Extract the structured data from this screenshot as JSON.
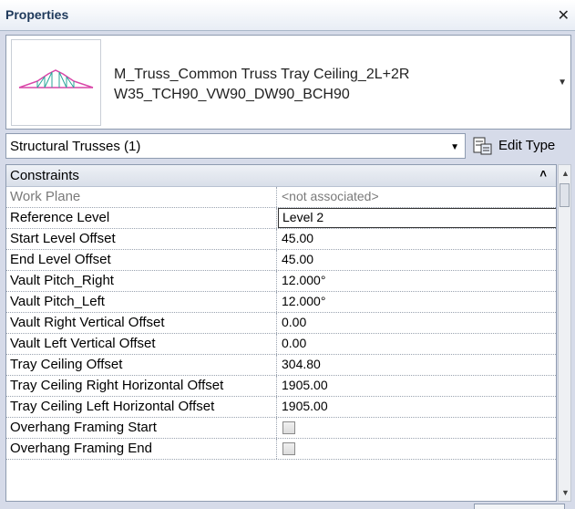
{
  "panel": {
    "title": "Properties",
    "close_glyph": "✕"
  },
  "type_selector": {
    "name_line1": "M_Truss_Common Truss Tray Ceiling_2L+2R",
    "name_line2": "W35_TCH90_VW90_DW90_BCH90",
    "arrow": "▼",
    "thumbnail_icon": "truss-thumbnail-icon"
  },
  "selection": {
    "label": "Structural Trusses (1)",
    "arrow": "▼",
    "edit_type_label": "Edit Type",
    "edit_type_icon": "edit-type-icon"
  },
  "group": {
    "label": "Constraints",
    "collapse_glyph": "«"
  },
  "rows": [
    {
      "name": "Work Plane",
      "value": "<not associated>"
    },
    {
      "name": "Reference Level",
      "value": "Level 2"
    },
    {
      "name": "Start Level Offset",
      "value": "45.00"
    },
    {
      "name": "End Level Offset",
      "value": "45.00"
    },
    {
      "name": "Vault Pitch_Right",
      "value": "12.000°"
    },
    {
      "name": "Vault Pitch_Left",
      "value": "12.000°"
    },
    {
      "name": "Vault Right Vertical Offset",
      "value": "0.00"
    },
    {
      "name": "Vault Left Vertical Offset",
      "value": "0.00"
    },
    {
      "name": "Tray Ceiling Offset",
      "value": "304.80"
    },
    {
      "name": "Tray Ceiling  Right Horizontal Offset",
      "value": "1905.00"
    },
    {
      "name": "Tray Ceiling Left Horizontal Offset",
      "value": "1905.00"
    },
    {
      "name": "Overhang Framing Start",
      "value": ""
    },
    {
      "name": "Overhang Framing End",
      "value": ""
    }
  ],
  "scrollbar": {
    "up": "▲",
    "down": "▼"
  },
  "colors": {
    "panel_bg": "#d6dbe9",
    "title_text": "#1e395b",
    "truss_color": "#d946a8",
    "truss_web": "#2aa59a"
  }
}
